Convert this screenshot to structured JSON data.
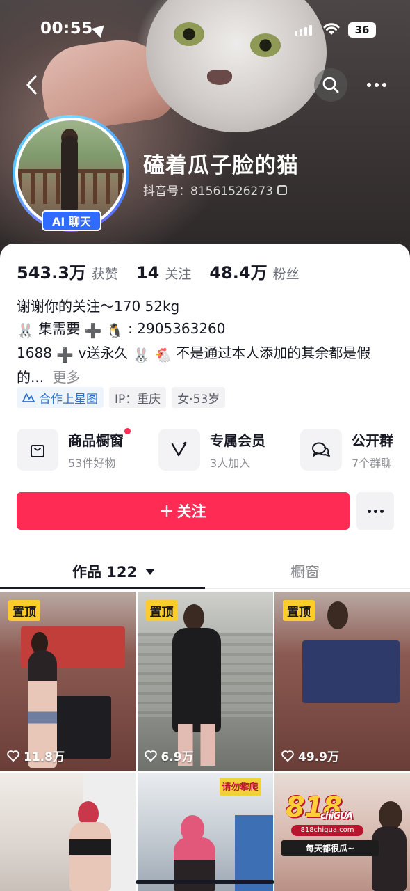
{
  "status_bar": {
    "time": "00:55",
    "battery": "36"
  },
  "profile": {
    "nickname": "磕着瓜子脸的猫",
    "douyin_id": "抖音号：81561526273",
    "ai_badge": "AI 聊天"
  },
  "stats": [
    {
      "value": "543.3万",
      "label": "获赞"
    },
    {
      "value": "14",
      "label": "关注"
    },
    {
      "value": "48.4万",
      "label": "粉丝"
    }
  ],
  "bio": {
    "line1": "谢谢你的关注～170 52kg",
    "line2_text": "集需要",
    "line2_qq": ": 2905363260",
    "line3_a": "1688",
    "line3_b": "v送永久",
    "line3_c": "不是通过本人添加的其余都是假",
    "line4": "的...",
    "more": "更多"
  },
  "tags": [
    {
      "label": "合作上星图",
      "icon": "star-map-icon"
    },
    {
      "label": "IP：重庆"
    },
    {
      "label": "女·53岁"
    }
  ],
  "services": [
    {
      "title": "商品橱窗",
      "subtitle": "53件好物",
      "icon": "shopping-bag-icon",
      "dot": true
    },
    {
      "title": "专属会员",
      "subtitle": "3人加入",
      "icon": "v-member-icon"
    },
    {
      "title": "公开群",
      "subtitle": "7个群聊",
      "icon": "chat-group-icon"
    }
  ],
  "actions": {
    "follow": "关注"
  },
  "tabs": {
    "works": "作品 122",
    "showcase": "橱窗"
  },
  "grid": [
    {
      "pinned": "置顶",
      "likes": "11.8万"
    },
    {
      "pinned": "置顶",
      "likes": "6.9万"
    },
    {
      "pinned": "置顶",
      "likes": "49.9万"
    },
    {},
    {
      "sign": "请勿攀爬"
    },
    {
      "ad_logo": "818",
      "ad_logo_suffix": "chiGUA",
      "ad_url": "818chigua.com",
      "ad_slogan": "每天都很瓜~"
    }
  ],
  "colors": {
    "accent": "#fe2c55",
    "pin": "#facd2a",
    "ai_badge": "#2f6bff",
    "link": "#2e70c9"
  }
}
